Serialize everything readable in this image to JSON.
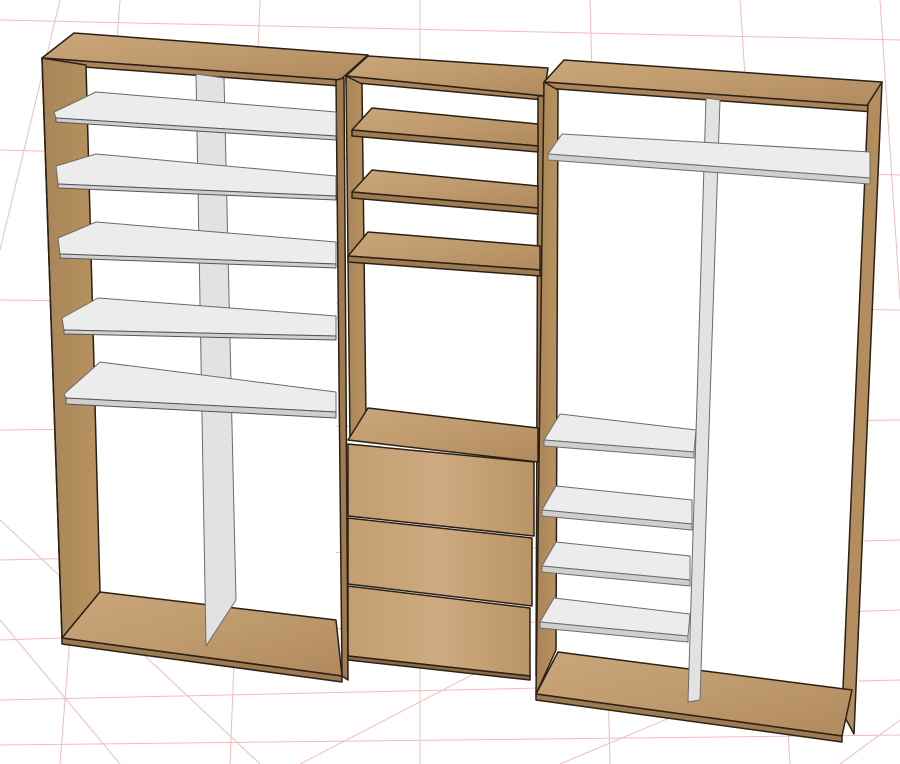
{
  "viewport": {
    "background": "#ffffff",
    "grid_color": "#f2bcbc"
  },
  "materials": {
    "wood_light": "#c9a57a",
    "wood_mid": "#b88f60",
    "wood_dark": "#8c6b47",
    "edge": "#2a2016",
    "shelf_top": "#ececec",
    "shelf_front": "#d2d2d2",
    "partition": "#e2e2e2"
  }
}
